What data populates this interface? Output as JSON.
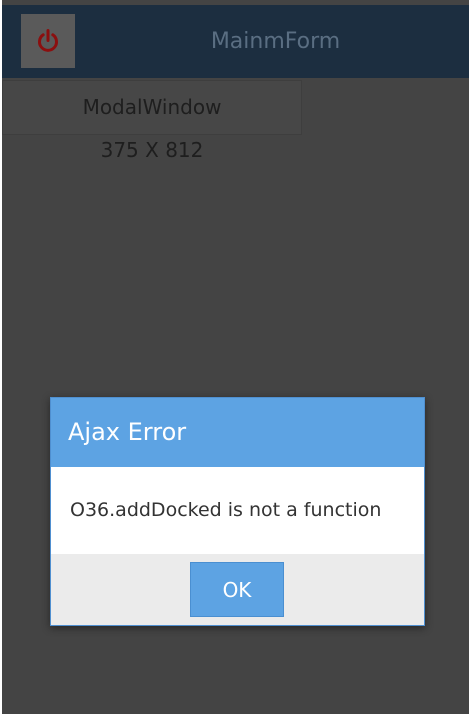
{
  "header": {
    "title": "MainmForm",
    "power_icon": "power-icon",
    "power_icon_color": "#8b0f0f"
  },
  "modal_tab": {
    "label": "ModalWindow"
  },
  "size_label": "375 X 812",
  "dialog": {
    "title": "Ajax Error",
    "message": "O36.addDocked is not a function",
    "ok_label": "OK"
  },
  "colors": {
    "header_bg": "#1c2e40",
    "background": "#444444",
    "dialog_accent": "#5da3e3",
    "dialog_footer": "#ebebeb"
  }
}
